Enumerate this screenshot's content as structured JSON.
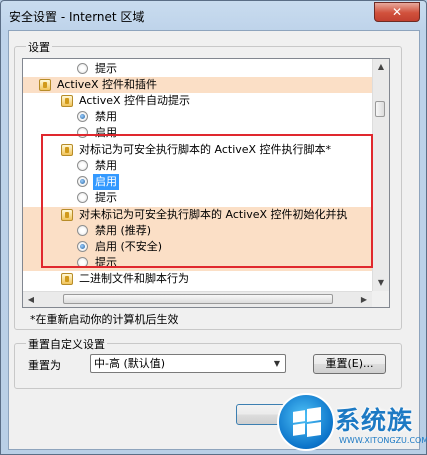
{
  "window": {
    "title": "安全设置 - Internet 区域",
    "close_label": "✕"
  },
  "settings": {
    "legend": "设置",
    "items": [
      {
        "kind": "radio",
        "label": "提示",
        "checked": false
      },
      {
        "kind": "category",
        "label": "ActiveX 控件和插件",
        "highlight": true
      },
      {
        "kind": "category",
        "label": "ActiveX 控件自动提示",
        "highlight": false
      },
      {
        "kind": "radio",
        "label": "禁用",
        "checked": true
      },
      {
        "kind": "radio",
        "label": "启用",
        "checked": false
      },
      {
        "kind": "category",
        "label": "对标记为可安全执行脚本的 ActiveX 控件执行脚本*",
        "highlight": false
      },
      {
        "kind": "radio",
        "label": "禁用",
        "checked": false
      },
      {
        "kind": "radio",
        "label": "启用",
        "checked": true,
        "selected": true
      },
      {
        "kind": "radio",
        "label": "提示",
        "checked": false
      },
      {
        "kind": "category",
        "label": "对未标记为可安全执行脚本的 ActiveX 控件初始化并执",
        "highlight": true
      },
      {
        "kind": "radio",
        "label": "禁用 (推荐)",
        "checked": false,
        "highlight": true
      },
      {
        "kind": "radio",
        "label": "启用 (不安全)",
        "checked": true,
        "highlight": true
      },
      {
        "kind": "radio",
        "label": "提示",
        "checked": false,
        "highlight": true
      },
      {
        "kind": "category",
        "label": "二进制文件和脚本行为",
        "highlight": false
      }
    ],
    "note": "*在重新启动你的计算机后生效"
  },
  "reset": {
    "legend": "重置自定义设置",
    "label": "重置为",
    "selected": "中-高 (默认值)",
    "button": "重置(E)..."
  },
  "watermark": {
    "brand": "系统族",
    "url": "WWW.XITONGZU.COM"
  }
}
